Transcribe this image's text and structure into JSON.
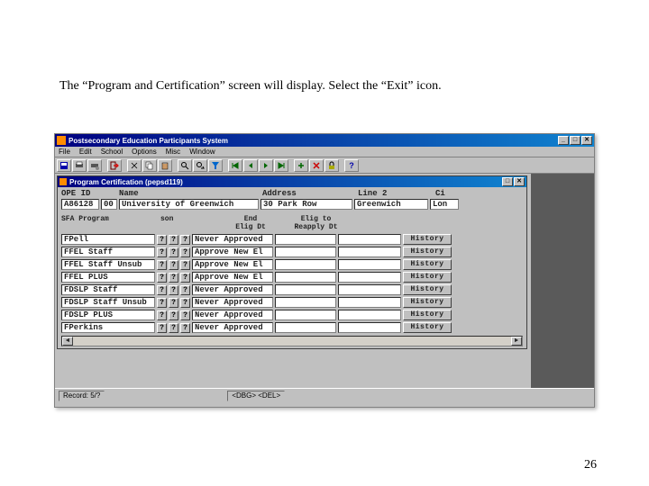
{
  "page": {
    "instruction": "The “Program and Certification” screen will display.  Select the “Exit” icon.",
    "page_number": "26"
  },
  "outer": {
    "title": "Postsecondary Education Participants System",
    "minimize": "_",
    "maximize": "□",
    "close": "✕",
    "menu": {
      "file": "File",
      "edit": "Edit",
      "school": "School",
      "options": "Options",
      "misc": "Misc",
      "window": "Window"
    }
  },
  "inner": {
    "title": "Program Certification  (pepsd119)",
    "close": "✕",
    "maximize": "□"
  },
  "header": {
    "labels": {
      "opi": "OPE ID",
      "name": "Name",
      "address": "Address",
      "line2": "Line 2",
      "ci": "Ci"
    },
    "values": {
      "opi": "A86128",
      "blank": "00",
      "name": "University of Greenwich",
      "address": "30 Park Row",
      "line2": "Greenwich",
      "ci": "Lon"
    }
  },
  "grid": {
    "headers": {
      "program": "SFA Program",
      "son": "son",
      "end": "End\nElig Dt",
      "elig": "Elig to\nReapply Dt",
      "history": "History"
    },
    "question": "?",
    "rows": [
      {
        "program": "FPell",
        "son": "Never Approved"
      },
      {
        "program": "FFEL Staff",
        "son": "Approve New El"
      },
      {
        "program": "FFEL Staff Unsub",
        "son": "Approve New El"
      },
      {
        "program": "FFEL PLUS",
        "son": "Approve New El"
      },
      {
        "program": "FDSLP Staff",
        "son": "Never Approved"
      },
      {
        "program": "FDSLP Staff Unsub",
        "son": "Never Approved"
      },
      {
        "program": "FDSLP PLUS",
        "son": "Never Approved"
      },
      {
        "program": "FPerkins",
        "son": "Never Approved"
      }
    ]
  },
  "status": {
    "record": "Record: 5/?",
    "kbd": "<DBG> <DEL>"
  }
}
